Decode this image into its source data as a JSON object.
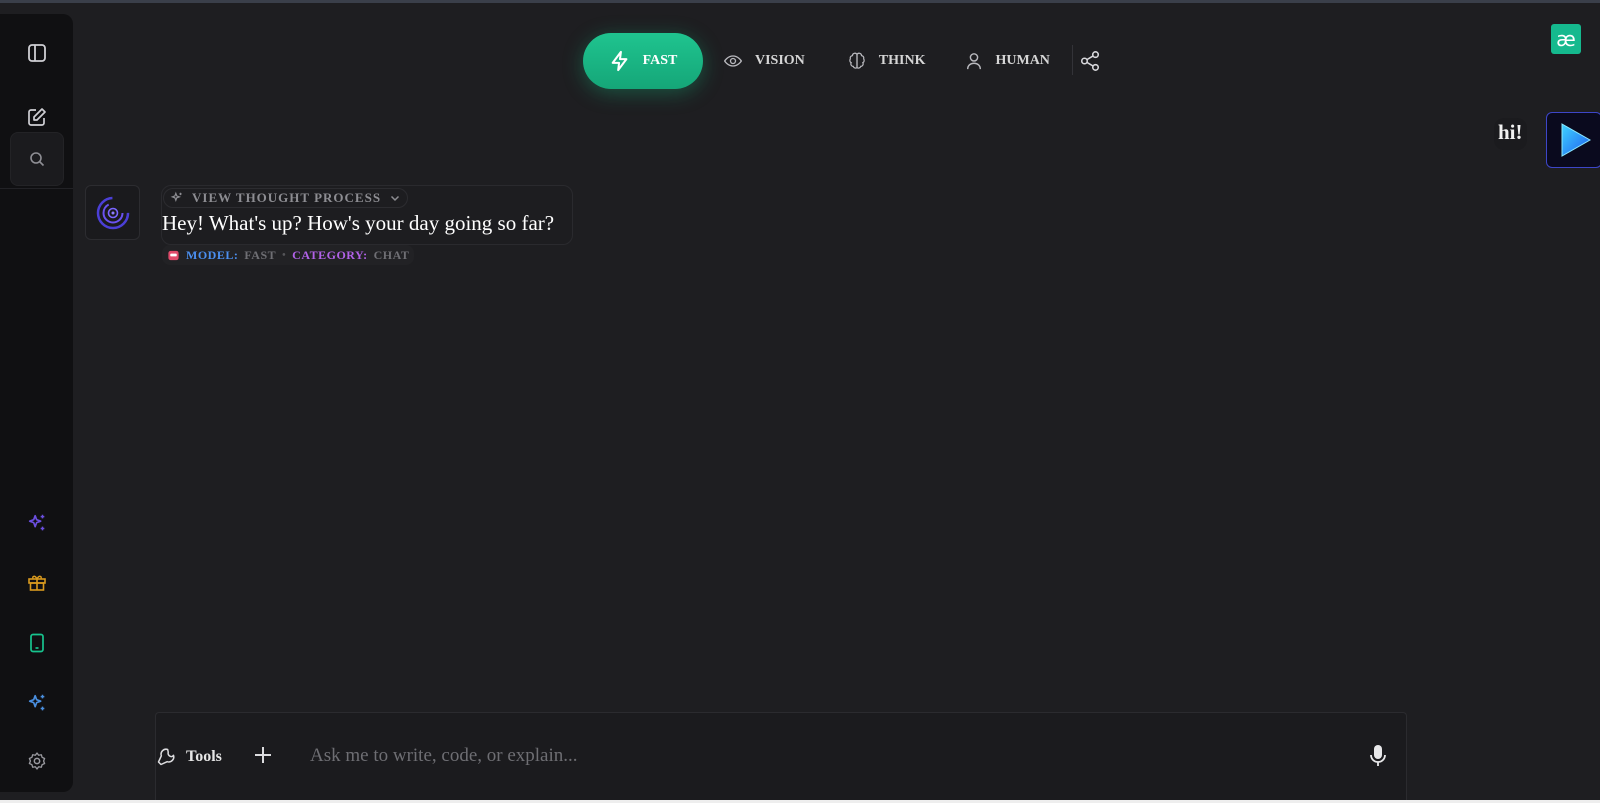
{
  "sidebar": {
    "top_icons": [
      "panel-toggle-icon",
      "new-chat-icon",
      "search-icon"
    ],
    "bottom_icons": [
      "sparkles-icon",
      "gift-icon",
      "tablet-icon",
      "sparkles-icon",
      "settings-icon"
    ],
    "colors": {
      "sparkles": "#6b4fe0",
      "gift": "#d99a1e",
      "tablet": "#17c48e",
      "sparkles2": "#4a8fe0",
      "settings": "#9a9aa0"
    }
  },
  "modes": {
    "items": [
      {
        "label": "FAST",
        "icon": "lightning-icon",
        "active": true
      },
      {
        "label": "VISION",
        "icon": "eye-icon",
        "active": false
      },
      {
        "label": "THINK",
        "icon": "brain-icon",
        "active": false
      },
      {
        "label": "HUMAN",
        "icon": "user-icon",
        "active": false
      }
    ],
    "share_icon": "share-icon",
    "accent": "#1fc48f"
  },
  "brand": {
    "logo_text": "æ",
    "color": "#15b98e"
  },
  "chat": {
    "user_message": "hi!",
    "bot": {
      "thought_label": "VIEW THOUGHT PROCESS",
      "text": "Hey! What's up? How's your day going so far?",
      "meta": {
        "model_key": "MODEL:",
        "model_value": "FAST",
        "separator": "•",
        "category_key": "CATEGORY:",
        "category_value": "CHAT"
      }
    }
  },
  "composer": {
    "tools_label": "Tools",
    "placeholder": "Ask me to write, code, or explain...",
    "value": ""
  }
}
